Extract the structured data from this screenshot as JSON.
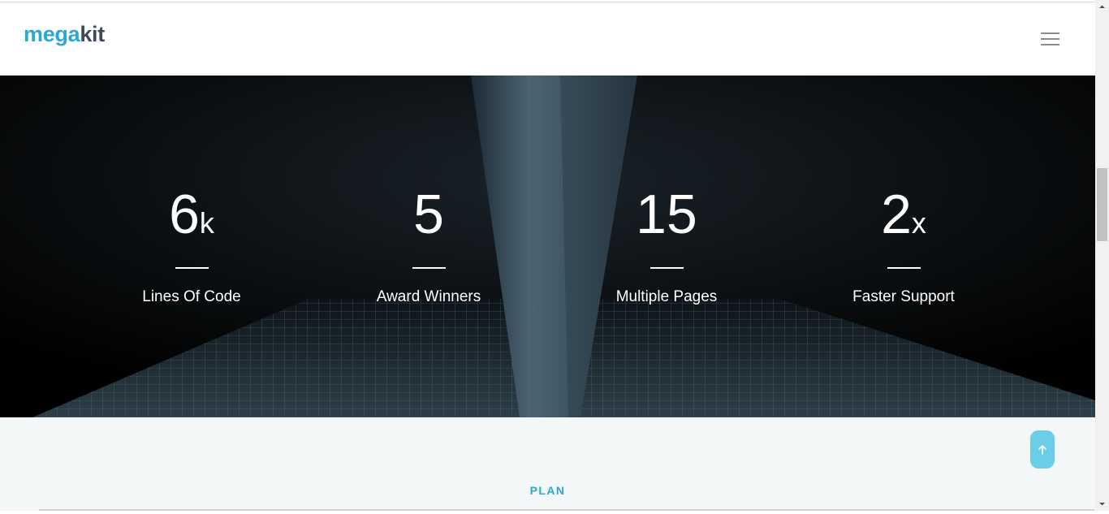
{
  "header": {
    "logo_part1": "mega",
    "logo_part2": "kit",
    "menu_icon": "hamburger-menu-icon"
  },
  "counters": [
    {
      "value": "6",
      "suffix": "k",
      "label": "Lines Of Code"
    },
    {
      "value": "5",
      "suffix": "",
      "label": "Award Winners"
    },
    {
      "value": "15",
      "suffix": "",
      "label": "Multiple Pages"
    },
    {
      "value": "2",
      "suffix": "x",
      "label": "Faster Support"
    }
  ],
  "plan": {
    "label": "PLAN"
  },
  "back_to_top": {
    "icon": "arrow-up-icon"
  },
  "colors": {
    "accent": "#2ba8cf",
    "logo_dark": "#3c4a5a",
    "button": "#6ccee6",
    "section_bg": "#f3f7f8"
  }
}
